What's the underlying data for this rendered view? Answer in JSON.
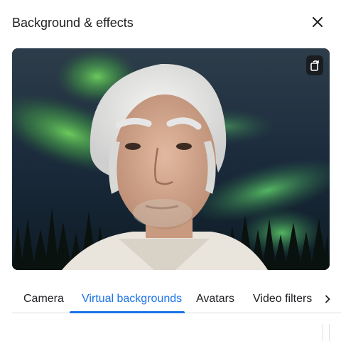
{
  "dialog": {
    "title": "Background & effects",
    "close_icon": "close-icon"
  },
  "preview": {
    "description_icon": "rotate-camera-icon",
    "background_name": "aurora-forest"
  },
  "tabs": {
    "items": [
      {
        "label": "Camera",
        "active": false
      },
      {
        "label": "Virtual backgrounds",
        "active": true
      },
      {
        "label": "Avatars",
        "active": false
      },
      {
        "label": "Video filters",
        "active": false
      }
    ],
    "next_icon": "chevron-right-icon"
  },
  "colors": {
    "accent": "#1a73e8",
    "divider": "#dadce0",
    "text": "#202124"
  }
}
